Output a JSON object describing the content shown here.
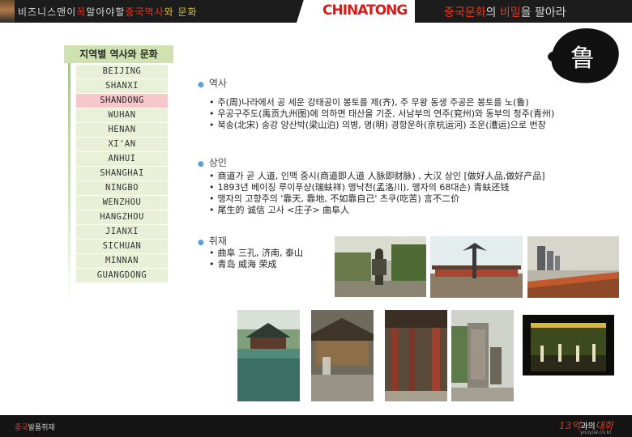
{
  "header": {
    "slogan_left_1": "비즈니스맨이",
    "slogan_left_2": "꼭",
    "slogan_left_3": "알아야할",
    "slogan_left_4": "중국역사",
    "slogan_left_5": "와 문화",
    "brand": "CHINATONG",
    "slogan_right_1": "중국문화",
    "slogan_right_2": "의 ",
    "slogan_right_3": "비밀",
    "slogan_right_4": "을 팔아라"
  },
  "stamp": {
    "char": "鲁"
  },
  "sidebar": {
    "title": "지역별 역사와 문화",
    "active": "SHANDONG",
    "items": [
      {
        "label": "BEIJING"
      },
      {
        "label": "SHANXI"
      },
      {
        "label": "SHANDONG"
      },
      {
        "label": "WUHAN"
      },
      {
        "label": "HENAN"
      },
      {
        "label": "XI'AN"
      },
      {
        "label": "ANHUI"
      },
      {
        "label": "SHANGHAI"
      },
      {
        "label": "NINGBO"
      },
      {
        "label": "WENZHOU"
      },
      {
        "label": "HANGZHOU"
      },
      {
        "label": "JIANXI"
      },
      {
        "label": "SICHUAN"
      },
      {
        "label": "MINNAN"
      },
      {
        "label": "GUANGDONG"
      }
    ]
  },
  "sections": {
    "history": {
      "heading": "역사",
      "lines": [
        "주(周)나라에서 공 세운 강태공이 봉토를 제(齐), 주 무왕 동생 주공은 봉토를 노(鲁)",
        "우공구주도(禹贡九州图)에 의하면 태산을 기준, 서남부의 연주(兖州)와 동부의 청주(青州)",
        "북송(北宋) 송강 양산박(梁山泊) 의병, 명(明) 경항운하(京杭运河) 조운(漕运)으로 번창"
      ]
    },
    "merchant": {
      "heading": "상인",
      "lines": [
        "商道가 곧 人道,  인맥 중시(商道即人道 人脉即财脉) , 大汉 상인 [做好人品,做好产品]",
        "1893년 베이징 루이푸샹(瑞蚨祥) 맹낙천(孟洛川), 맹자의 68대손) 青蚨还钱",
        "맹자의 고향주의 '靠天, 靠地, 不如靠自己' 츠쿠(吃苦) 言不二价",
        "尾生的 诚信 고사 <庄子> 曲阜人"
      ]
    },
    "coverage": {
      "heading": "취재",
      "lines": [
        "曲阜 三孔, 济南, 泰山",
        "青岛 威海 荣成"
      ]
    }
  },
  "footer": {
    "label_red": "중국",
    "label_rest": "발품취재",
    "logo_red": "13억",
    "logo_white": "과의",
    "logo_red2": "대화",
    "url": "youyue.co.kr"
  },
  "colors": {
    "accent": "#d81a1a",
    "sidebar_item": "#e8f1d8",
    "sidebar_active": "#f6c7cb",
    "sidebar_title": "#cfe2b0",
    "bullet_dot": "#5aa0d6"
  }
}
